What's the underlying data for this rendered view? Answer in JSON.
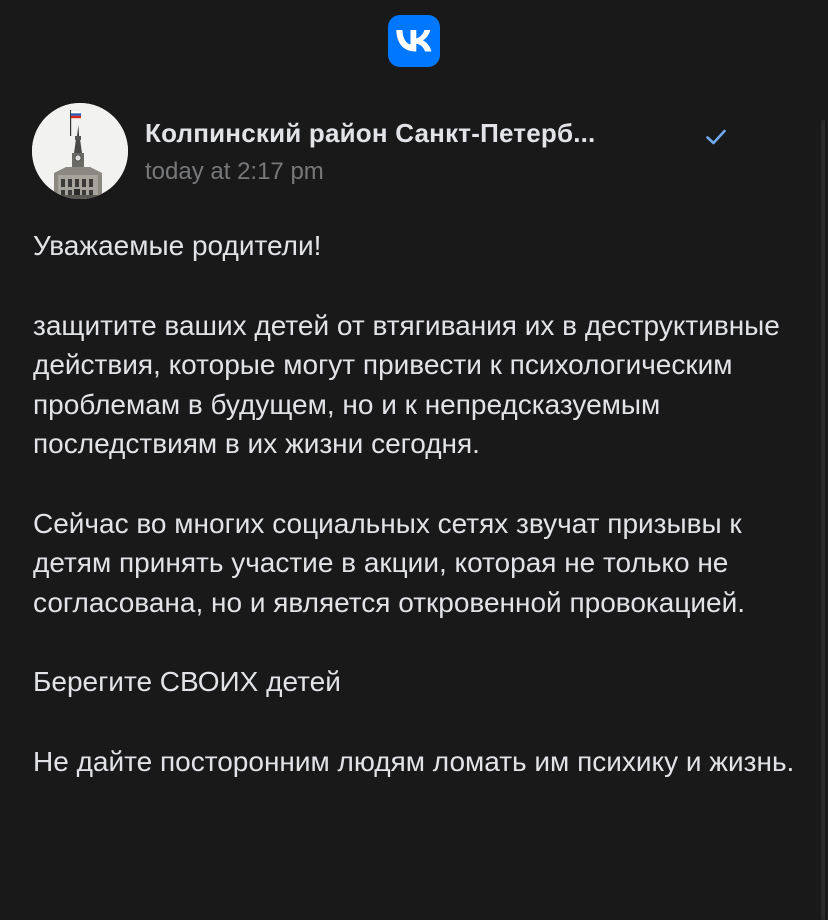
{
  "app": {
    "logo_icon": "vk-logo-icon",
    "accent": "#0077ff"
  },
  "post": {
    "author": "Колпинский район Санкт-Петерб...",
    "verified_icon": "checkmark-icon",
    "time": "today at 2:17 pm",
    "paragraphs": [
      "Уважаемые родители!",
      "защитите ваших детей от втягивания их в деструктивные действия, которые могут привести к психологическим проблемам в будущем, но и к непредсказуемым последствиям в их жизни сегодня.",
      "Сейчас во многих социальных сетях звучат призывы к детям принять участие в акции, которая не только не согласована, но и является откровенной провокацией.",
      "Берегите СВОИХ детей",
      "Не дайте посторонним людям ломать им психику и жизнь."
    ]
  },
  "colors": {
    "background": "#19191a",
    "text": "#e1e3e6",
    "secondary_text": "#76787a",
    "verified": "#71aaeb"
  }
}
